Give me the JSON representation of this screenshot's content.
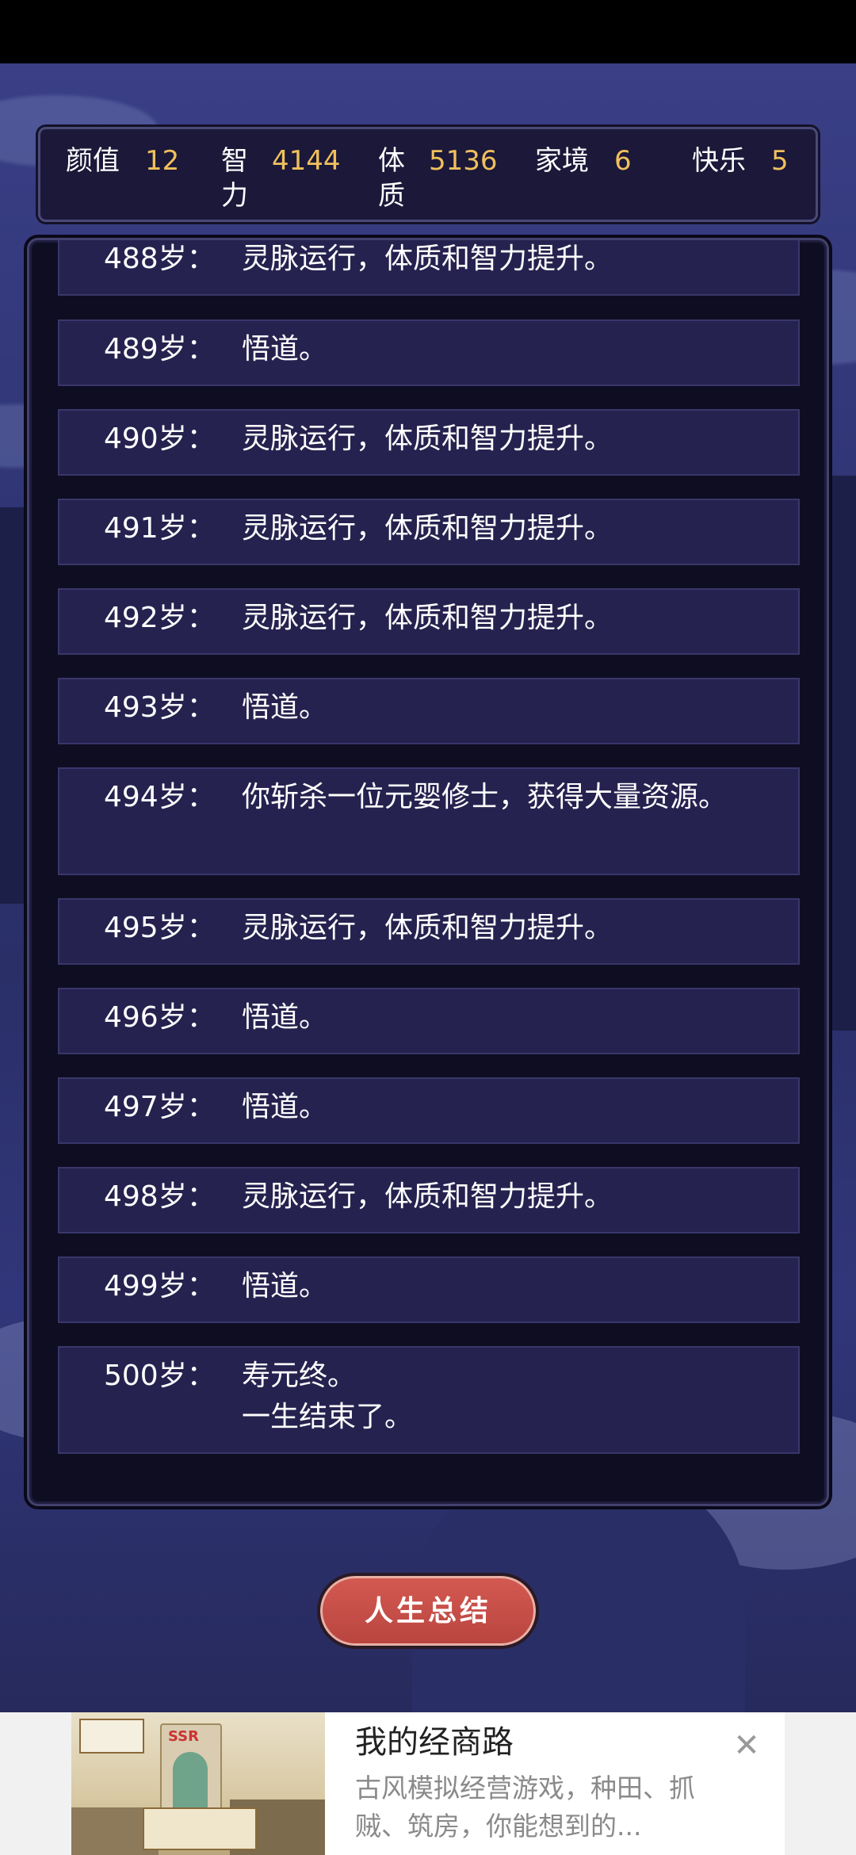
{
  "stats": [
    {
      "label": "颜值",
      "value": "12"
    },
    {
      "label": "智力",
      "value": "4144"
    },
    {
      "label": "体质",
      "value": "5136"
    },
    {
      "label": "家境",
      "value": "6"
    },
    {
      "label": "快乐",
      "value": "5"
    }
  ],
  "log": [
    {
      "age": "488岁：",
      "text": "灵脉运行，体质和智力提升。"
    },
    {
      "age": "489岁：",
      "text": "悟道。"
    },
    {
      "age": "490岁：",
      "text": "灵脉运行，体质和智力提升。"
    },
    {
      "age": "491岁：",
      "text": "灵脉运行，体质和智力提升。"
    },
    {
      "age": "492岁：",
      "text": "灵脉运行，体质和智力提升。"
    },
    {
      "age": "493岁：",
      "text": "悟道。"
    },
    {
      "age": "494岁：",
      "text": "你斩杀一位元婴修士，获得大量资源。"
    },
    {
      "age": "495岁：",
      "text": "灵脉运行，体质和智力提升。"
    },
    {
      "age": "496岁：",
      "text": "悟道。"
    },
    {
      "age": "497岁：",
      "text": "悟道。"
    },
    {
      "age": "498岁：",
      "text": "灵脉运行，体质和智力提升。"
    },
    {
      "age": "499岁：",
      "text": "悟道。"
    },
    {
      "age": "500岁：",
      "text": "寿元终。\n一生结束了。"
    }
  ],
  "summary_button": "人生总结",
  "ad": {
    "title": "我的经商路",
    "description": "古风模拟经营游戏，种田、抓贼、筑房，你能想到的...",
    "image_badge": "SSR",
    "close_icon": "close-icon"
  }
}
